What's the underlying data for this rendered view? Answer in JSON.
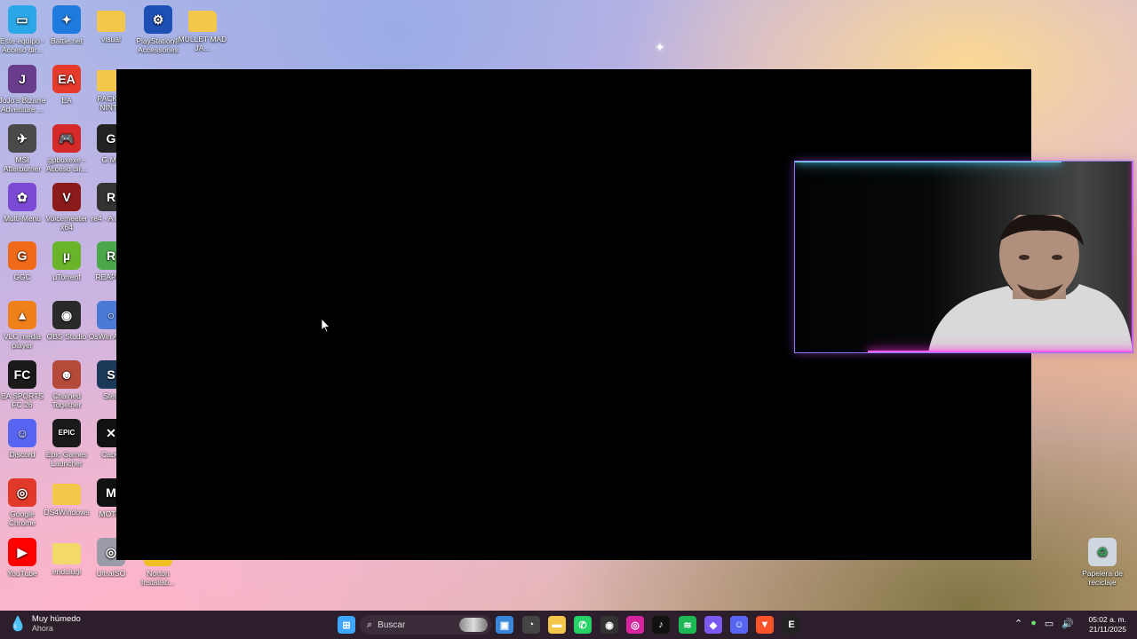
{
  "desktop": {
    "icons": [
      {
        "label": "Este equipo - Acceso dir...",
        "icon": "monitor-icon",
        "color": "#2aa7e6",
        "glyph": "▭"
      },
      {
        "label": "Battle.net",
        "icon": "battlenet-icon",
        "color": "#1f7ae0",
        "glyph": "✦"
      },
      {
        "label": "visual",
        "icon": "folder-icon",
        "color": "#f3c84a",
        "glyph": ""
      },
      {
        "label": "PlayStation® Accessories",
        "icon": "playstation-icon",
        "color": "#1e4fb4",
        "glyph": "⚙"
      },
      {
        "label": "MULLET MAD JA...",
        "icon": "folder-icon",
        "color": "#f3c84a",
        "glyph": ""
      },
      {
        "label": "JoJo's Bizarre Adventure ...",
        "icon": "jojo-icon",
        "color": "#6a3d8c",
        "glyph": "J"
      },
      {
        "label": "EA",
        "icon": "ea-icon",
        "color": "#e63a2a",
        "glyph": "EA"
      },
      {
        "label": "PACK C NINTE",
        "icon": "folder-icon",
        "color": "#f3c84a",
        "glyph": ""
      },
      {
        "label": "MSI Afterburner",
        "icon": "msi-afterburner-icon",
        "color": "#4a4a4a",
        "glyph": "✈"
      },
      {
        "label": "gpbuxexe - Acceso dir...",
        "icon": "gamepad-icon",
        "color": "#d62a2a",
        "glyph": "🎮"
      },
      {
        "label": "G Me",
        "icon": "g-icon",
        "color": "#222",
        "glyph": "G"
      },
      {
        "label": "Multi-Menu",
        "icon": "multimenu-icon",
        "color": "#7c4bd6",
        "glyph": "✿"
      },
      {
        "label": "Voicemeeter x64",
        "icon": "voicemeeter-icon",
        "color": "#8b1a1a",
        "glyph": "V"
      },
      {
        "label": "re4 - A direc",
        "icon": "re4-icon",
        "color": "#333",
        "glyph": "R"
      },
      {
        "label": "GGC",
        "icon": "ggc-icon",
        "color": "#f06a1a",
        "glyph": "G"
      },
      {
        "label": "µTorrent",
        "icon": "utorrent-icon",
        "color": "#6ab42a",
        "glyph": "µ"
      },
      {
        "label": "REAPER",
        "icon": "reaper-icon",
        "color": "#4aa84a",
        "glyph": "R"
      },
      {
        "label": "VLC media player",
        "icon": "vlc-icon",
        "color": "#f0801a",
        "glyph": "▲"
      },
      {
        "label": "OBS Studio",
        "icon": "obs-icon",
        "color": "#2a2a2a",
        "glyph": "◉"
      },
      {
        "label": "OsWin Acces",
        "icon": "oswin-icon",
        "color": "#4a7ad6",
        "glyph": "○"
      },
      {
        "label": "EA SPORTS FC 26",
        "icon": "fc26-icon",
        "color": "#1a1a1a",
        "glyph": "FC"
      },
      {
        "label": "Chained Together",
        "icon": "chained-together-icon",
        "color": "#b44a3a",
        "glyph": "☻"
      },
      {
        "label": "Stea",
        "icon": "steam-icon",
        "color": "#1b3a5a",
        "glyph": "S"
      },
      {
        "label": "Discord",
        "icon": "discord-icon",
        "color": "#5865f2",
        "glyph": "☺"
      },
      {
        "label": "Epic Games Launcher",
        "icon": "epic-games-icon",
        "color": "#1a1a1a",
        "glyph": "EPIC"
      },
      {
        "label": "CapC",
        "icon": "capcut-icon",
        "color": "#111",
        "glyph": "✕"
      },
      {
        "label": "Google Chrome",
        "icon": "chrome-icon",
        "color": "#e23a2a",
        "glyph": "◎"
      },
      {
        "label": "DS4Windows",
        "icon": "folder-icon",
        "color": "#f3c84a",
        "glyph": ""
      },
      {
        "label": "MOTIV",
        "icon": "motiv-icon",
        "color": "#111",
        "glyph": "M"
      },
      {
        "label": "YouTube",
        "icon": "youtube-icon",
        "color": "#ff0000",
        "glyph": "▶"
      },
      {
        "label": "endulugi",
        "icon": "folder-icon",
        "color": "#f3d86a",
        "glyph": ""
      },
      {
        "label": "UltraISO",
        "icon": "ultraiso-icon",
        "color": "#9a9aa8",
        "glyph": "◎"
      },
      {
        "label": "Norton Installati...",
        "icon": "norton-icon",
        "color": "#f0c020",
        "glyph": "✓"
      },
      {
        "label": "Papelera de reciclaje",
        "icon": "recycle-bin-icon",
        "color": "#cfd8e0",
        "glyph": "♻"
      }
    ]
  },
  "taskbar": {
    "weather_title": "Muy húmedo",
    "weather_sub": "Ahora",
    "search_placeholder": "Buscar",
    "time": "05:02 a. m.",
    "date": "21/11/2025",
    "apps": [
      {
        "name": "start-button",
        "color": "#3ea6ff",
        "glyph": "⊞"
      },
      {
        "name": "store-icon",
        "color": "#3a86d8",
        "glyph": "▣"
      },
      {
        "name": "speed-icon",
        "color": "#444",
        "glyph": "◔"
      },
      {
        "name": "file-explorer-icon",
        "color": "#f3c84a",
        "glyph": "▬"
      },
      {
        "name": "whatsapp-icon",
        "color": "#25d366",
        "glyph": "✆"
      },
      {
        "name": "obs-taskbar-icon",
        "color": "#333",
        "glyph": "◉"
      },
      {
        "name": "instagram-icon",
        "color": "#d6249f",
        "glyph": "◎"
      },
      {
        "name": "tiktok-icon",
        "color": "#111",
        "glyph": "♪"
      },
      {
        "name": "spotify-icon",
        "color": "#1db954",
        "glyph": "≋"
      },
      {
        "name": "gem-icon",
        "color": "#7a5af0",
        "glyph": "◆"
      },
      {
        "name": "discord-taskbar-icon",
        "color": "#5865f2",
        "glyph": "☺"
      },
      {
        "name": "brave-icon",
        "color": "#fb542b",
        "glyph": "▼"
      },
      {
        "name": "epic-taskbar-icon",
        "color": "#222",
        "glyph": "E"
      }
    ]
  }
}
